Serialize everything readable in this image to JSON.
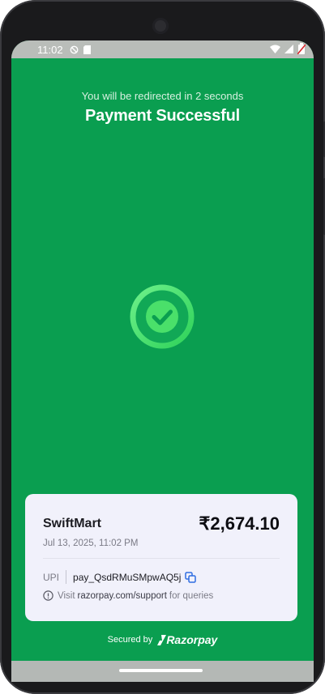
{
  "status_bar": {
    "time": "11:02",
    "icons_left": [
      "do-not-disturb-icon",
      "sd-card-icon"
    ],
    "icons_right": [
      "wifi-icon",
      "signal-icon",
      "battery-icon"
    ]
  },
  "header": {
    "redirect_message": "You will be redirected in 2 seconds",
    "title": "Payment Successful"
  },
  "status_icon": "check-circle-icon",
  "payment_card": {
    "merchant": "SwiftMart",
    "amount": "₹2,674.10",
    "datetime": "Jul 13, 2025, 11:02 PM",
    "method_label": "UPI",
    "payment_id": "pay_QsdRMuSMpwAQ5j",
    "support_prefix": "Visit",
    "support_link": "razorpay.com/support",
    "support_suffix": "for queries"
  },
  "footer": {
    "secured_by": "Secured by",
    "brand": "Razorpay"
  },
  "colors": {
    "background": "#0a9e50",
    "check_ring": "#4ae06a",
    "card_bg": "#f1f1fb",
    "copy_icon": "#2f6de1"
  }
}
